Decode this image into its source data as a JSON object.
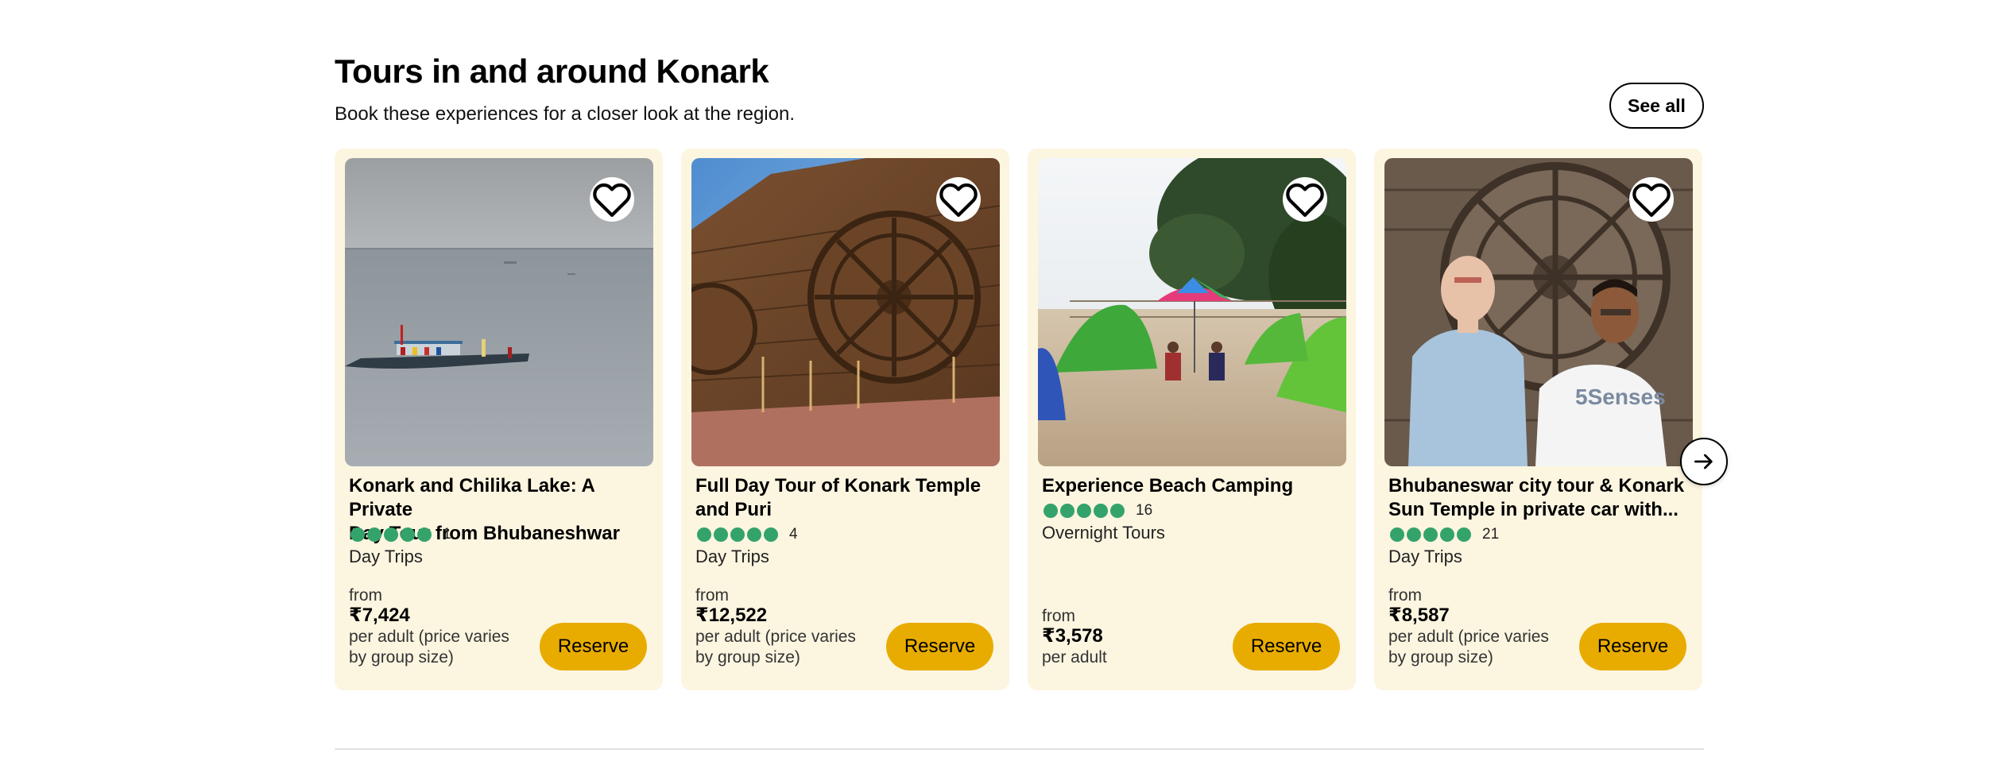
{
  "section": {
    "title": "Tours in and around Konark",
    "subtitle": "Book these experiences for a closer look at the region.",
    "see_all_label": "See all"
  },
  "cards": [
    {
      "title_line1": "Konark and Chilika Lake: A Private",
      "title_line2": "Day Tour from Bhubaneshwar",
      "rating_bubbles": 5,
      "review_count": "1",
      "category": "Day Trips",
      "from_label": "from",
      "price": "₹7,424",
      "price_note_line1": "per adult (price varies",
      "price_note_line2": "by group size)",
      "reserve_label": "Reserve",
      "image": "boat-on-lake-photo"
    },
    {
      "title_line1": "Full Day Tour of Konark Temple",
      "title_line2": "and Puri",
      "rating_bubbles": 5,
      "review_count": "4",
      "category": "Day Trips",
      "from_label": "from",
      "price": "₹12,522",
      "price_note_line1": "per adult (price varies",
      "price_note_line2": "by group size)",
      "reserve_label": "Reserve",
      "image": "konark-temple-wheel-photo"
    },
    {
      "title_line1": "Experience Beach Camping",
      "title_line2": "",
      "rating_bubbles": 5,
      "review_count": "16",
      "category": "Overnight Tours",
      "from_label": "from",
      "price": "₹3,578",
      "price_note_line1": "per adult",
      "price_note_line2": "",
      "reserve_label": "Reserve",
      "image": "beach-tents-photo"
    },
    {
      "title_line1": "Bhubaneswar city tour & Konark",
      "title_line2": "Sun Temple in private car with...",
      "rating_bubbles": 5,
      "review_count": "21",
      "category": "Day Trips",
      "from_label": "from",
      "price": "₹8,587",
      "price_note_line1": "per adult (price varies",
      "price_note_line2": "by group size)",
      "reserve_label": "Reserve",
      "image": "two-men-at-temple-wheel-photo"
    }
  ],
  "icons": {
    "save": "heart-icon",
    "next": "arrow-right-icon"
  },
  "colors": {
    "card_bg": "#fcf5e0",
    "reserve_bg": "#e8ac00",
    "rating_green": "#34a36b"
  }
}
